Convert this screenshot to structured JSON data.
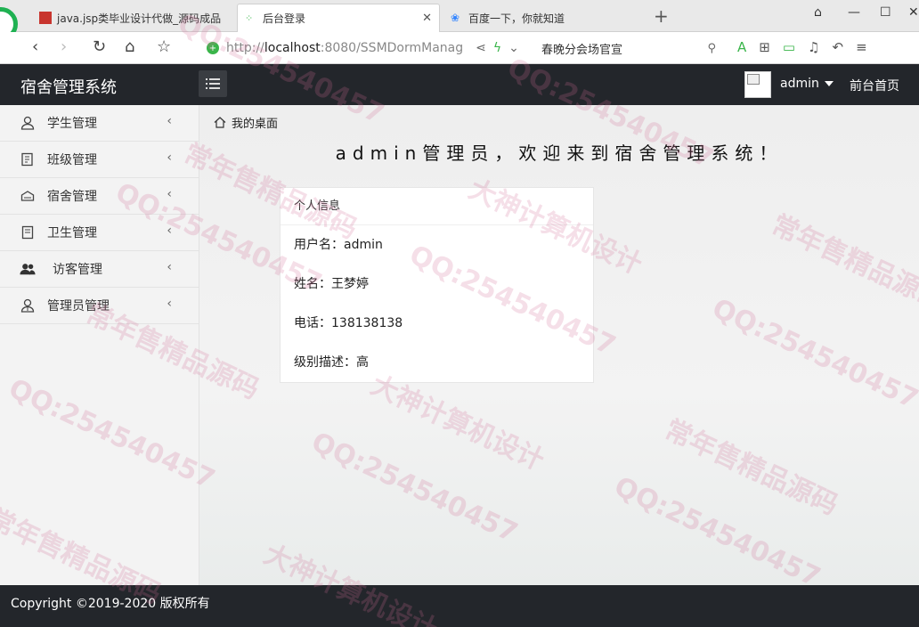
{
  "browser": {
    "tabs": [
      {
        "title": "java.jsp类毕业设计代做_源码成品",
        "active": false
      },
      {
        "title": "后台登录",
        "active": true
      },
      {
        "title": "百度一下，你就知道",
        "active": false
      }
    ],
    "address": {
      "prefix": "http://",
      "host": "localhost",
      "rest": ":8080/SSMDormManag"
    },
    "search_text": "春晚分会场官宣"
  },
  "header": {
    "app_title": "宿舍管理系统",
    "username": "admin",
    "home_link": "前台首页"
  },
  "sidebar": {
    "items": [
      {
        "label": "学生管理",
        "icon": "user-icon"
      },
      {
        "label": "班级管理",
        "icon": "class-icon"
      },
      {
        "label": "宿舍管理",
        "icon": "dorm-icon"
      },
      {
        "label": "卫生管理",
        "icon": "notes-icon"
      },
      {
        "label": "访客管理",
        "icon": "visitors-icon"
      },
      {
        "label": "管理员管理",
        "icon": "admin-icon"
      }
    ]
  },
  "main": {
    "breadcrumb": "我的桌面",
    "welcome": "admin管理员，欢迎来到宿舍管理系统！",
    "card": {
      "title": "个人信息",
      "rows": [
        "用户名：admin",
        "姓名：王梦婷",
        "电话：138138138",
        "级别描述：高"
      ]
    }
  },
  "footer": {
    "copyright": "Copyright ©2019-2020 版权所有"
  },
  "watermarks": {
    "qq": "QQ:254540457",
    "slogan1": "常年售精品源码",
    "slogan2": "大神计算机设计"
  }
}
